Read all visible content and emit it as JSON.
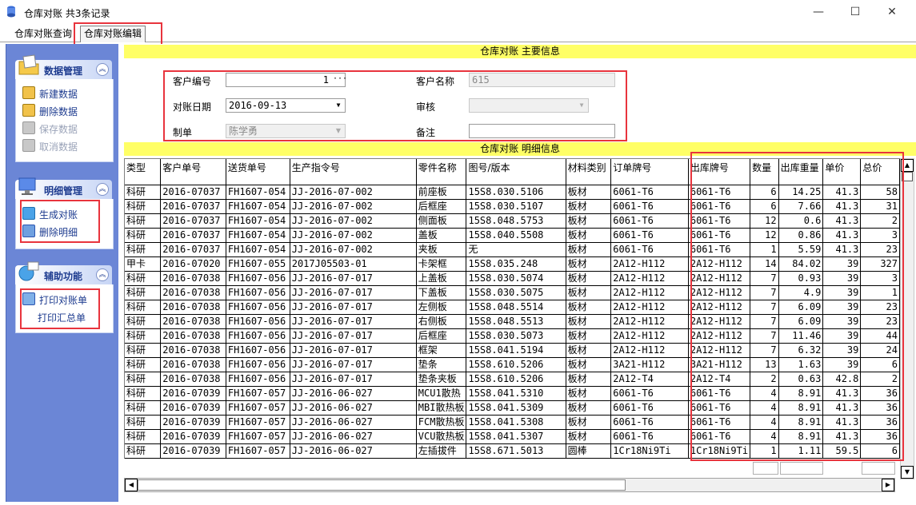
{
  "window": {
    "title": "仓库对账 共3条记录",
    "minimize": "—",
    "maximize": "☐",
    "close": "✕"
  },
  "tabs": [
    {
      "label": "仓库对账查询"
    },
    {
      "label": "仓库对账编辑"
    }
  ],
  "sidebar": {
    "sections": [
      {
        "title": "数据管理",
        "items": [
          {
            "label": "新建数据"
          },
          {
            "label": "删除数据"
          },
          {
            "label": "保存数据"
          },
          {
            "label": "取消数据"
          }
        ]
      },
      {
        "title": "明细管理",
        "items": [
          {
            "label": "生成对账"
          },
          {
            "label": "删除明细"
          }
        ]
      },
      {
        "title": "辅助功能",
        "items": [
          {
            "label": "打印对账单"
          },
          {
            "label": "打印汇总单"
          }
        ]
      }
    ]
  },
  "main_info": {
    "banner": "仓库对账 主要信息",
    "customer_no_label": "客户编号",
    "customer_no": "1",
    "customer_name_label": "客户名称",
    "customer_name": "615",
    "date_label": "对账日期",
    "date": "2016-09-13",
    "audit_label": "审核",
    "audit": "",
    "maker_label": "制单",
    "maker": "陈学勇",
    "remark_label": "备注",
    "remark": ""
  },
  "detail": {
    "banner": "仓库对账 明细信息",
    "columns": [
      "类型",
      "客户单号",
      "送货单号",
      "生产指令号",
      "零件名称",
      "图号/版本",
      "材料类别",
      "订单牌号",
      "出库牌号",
      "数量",
      "出库重量",
      "单价",
      "总价"
    ],
    "rows": [
      [
        "科研",
        "2016-07037",
        "FH1607-054",
        "JJ-2016-07-002",
        "前座板",
        "15S8.030.5106",
        "板材",
        "6061-T6",
        "6061-T6",
        "6",
        "14.25",
        "41.3",
        "58"
      ],
      [
        "科研",
        "2016-07037",
        "FH1607-054",
        "JJ-2016-07-002",
        "后框座",
        "15S8.030.5107",
        "板材",
        "6061-T6",
        "6061-T6",
        "6",
        "7.66",
        "41.3",
        "31"
      ],
      [
        "科研",
        "2016-07037",
        "FH1607-054",
        "JJ-2016-07-002",
        "侧面板",
        "15S8.048.5753",
        "板材",
        "6061-T6",
        "6061-T6",
        "12",
        "0.6",
        "41.3",
        "2"
      ],
      [
        "科研",
        "2016-07037",
        "FH1607-054",
        "JJ-2016-07-002",
        "盖板",
        "15S8.040.5508",
        "板材",
        "6061-T6",
        "6061-T6",
        "12",
        "0.86",
        "41.3",
        "3"
      ],
      [
        "科研",
        "2016-07037",
        "FH1607-054",
        "JJ-2016-07-002",
        "夹板",
        "无",
        "板材",
        "6061-T6",
        "6061-T6",
        "1",
        "5.59",
        "41.3",
        "23"
      ],
      [
        "甲卡",
        "2016-07020",
        "FH1607-055",
        "2017J05503-01",
        "卡架框",
        "15S8.035.248",
        "板材",
        "2A12-H112",
        "2A12-H112",
        "14",
        "84.02",
        "39",
        "327"
      ],
      [
        "科研",
        "2016-07038",
        "FH1607-056",
        "JJ-2016-07-017",
        "上盖板",
        "15S8.030.5074",
        "板材",
        "2A12-H112",
        "2A12-H112",
        "7",
        "0.93",
        "39",
        "3"
      ],
      [
        "科研",
        "2016-07038",
        "FH1607-056",
        "JJ-2016-07-017",
        "下盖板",
        "15S8.030.5075",
        "板材",
        "2A12-H112",
        "2A12-H112",
        "7",
        "4.9",
        "39",
        "1"
      ],
      [
        "科研",
        "2016-07038",
        "FH1607-056",
        "JJ-2016-07-017",
        "左侧板",
        "15S8.048.5514",
        "板材",
        "2A12-H112",
        "2A12-H112",
        "7",
        "6.09",
        "39",
        "23"
      ],
      [
        "科研",
        "2016-07038",
        "FH1607-056",
        "JJ-2016-07-017",
        "右侧板",
        "15S8.048.5513",
        "板材",
        "2A12-H112",
        "2A12-H112",
        "7",
        "6.09",
        "39",
        "23"
      ],
      [
        "科研",
        "2016-07038",
        "FH1607-056",
        "JJ-2016-07-017",
        "后框座",
        "15S8.030.5073",
        "板材",
        "2A12-H112",
        "2A12-H112",
        "7",
        "11.46",
        "39",
        "44"
      ],
      [
        "科研",
        "2016-07038",
        "FH1607-056",
        "JJ-2016-07-017",
        "框架",
        "15S8.041.5194",
        "板材",
        "2A12-H112",
        "2A12-H112",
        "7",
        "6.32",
        "39",
        "24"
      ],
      [
        "科研",
        "2016-07038",
        "FH1607-056",
        "JJ-2016-07-017",
        "垫条",
        "15S8.610.5206",
        "板材",
        "3A21-H112",
        "3A21-H112",
        "13",
        "1.63",
        "39",
        "6"
      ],
      [
        "科研",
        "2016-07038",
        "FH1607-056",
        "JJ-2016-07-017",
        "垫条夹板",
        "15S8.610.5206",
        "板材",
        "2A12-T4",
        "2A12-T4",
        "2",
        "0.63",
        "42.8",
        "2"
      ],
      [
        "科研",
        "2016-07039",
        "FH1607-057",
        "JJ-2016-06-027",
        "MCU1散热",
        "15S8.041.5310",
        "板材",
        "6061-T6",
        "6061-T6",
        "4",
        "8.91",
        "41.3",
        "36"
      ],
      [
        "科研",
        "2016-07039",
        "FH1607-057",
        "JJ-2016-06-027",
        "MBI散热板",
        "15S8.041.5309",
        "板材",
        "6061-T6",
        "6061-T6",
        "4",
        "8.91",
        "41.3",
        "36"
      ],
      [
        "科研",
        "2016-07039",
        "FH1607-057",
        "JJ-2016-06-027",
        "FCM散热板",
        "15S8.041.5308",
        "板材",
        "6061-T6",
        "6061-T6",
        "4",
        "8.91",
        "41.3",
        "36"
      ],
      [
        "科研",
        "2016-07039",
        "FH1607-057",
        "JJ-2016-06-027",
        "VCU散热板",
        "15S8.041.5307",
        "板材",
        "6061-T6",
        "6061-T6",
        "4",
        "8.91",
        "41.3",
        "36"
      ],
      [
        "科研",
        "2016-07039",
        "FH1607-057",
        "JJ-2016-06-027",
        "左插拔件",
        "15S8.671.5013",
        "圆棒",
        "1Cr18Ni9Ti",
        "1Cr18Ni9Ti",
        "1",
        "1.11",
        "59.5",
        "6"
      ]
    ]
  }
}
